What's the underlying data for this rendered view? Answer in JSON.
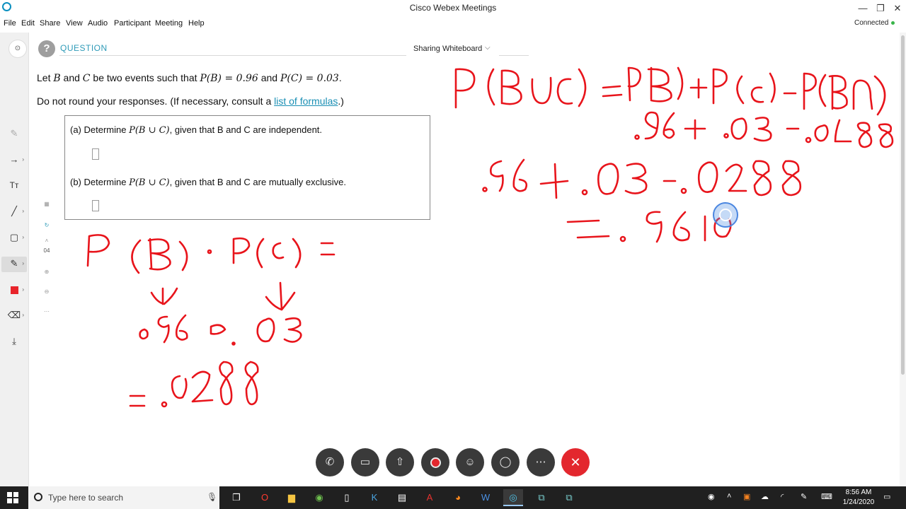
{
  "window": {
    "title": "Cisco Webex Meetings",
    "minimize": "—",
    "maximize": "❐",
    "close": "✕"
  },
  "menu": [
    "File",
    "Edit",
    "Share",
    "View",
    "Audio",
    "Participant",
    "Meeting",
    "Help"
  ],
  "status": "Connected",
  "toolbar": {
    "page_number": "04"
  },
  "share": {
    "label": "Sharing Whiteboard"
  },
  "question": {
    "header": "QUESTION",
    "intro_1": "Let ",
    "B": "B",
    "intro_2": " and ",
    "C": "C",
    "intro_3": " be two events such that ",
    "pb_expr": "P(B) = 0.96",
    "intro_4": " and ",
    "pc_expr": "P(C) = 0.03",
    "intro_5": ".",
    "round_note": "Do not round your responses. (If necessary, consult a ",
    "formulas_link": "list of formulas",
    "round_note_end": ".)",
    "part_a_label": "(a)  Determine ",
    "part_a_expr": "P(B ∪ C)",
    "part_a_text": ", given that B and C are independent.",
    "part_b_label": "(b)  Determine ",
    "part_b_expr": "P(B ∪ C)",
    "part_b_text": ", given that B and C are mutually exclusive."
  },
  "controls": [
    "phone-icon",
    "video-icon",
    "share-icon",
    "record-icon",
    "participants-icon",
    "chat-icon",
    "more-icon",
    "end-icon"
  ],
  "taskbar": {
    "search_placeholder": "Type here to search",
    "time": "8:56 AM",
    "date": "1/24/2020"
  },
  "colors": {
    "ink": "#e8141b",
    "accent": "#2f9bb8",
    "end_call": "#e3272e"
  }
}
